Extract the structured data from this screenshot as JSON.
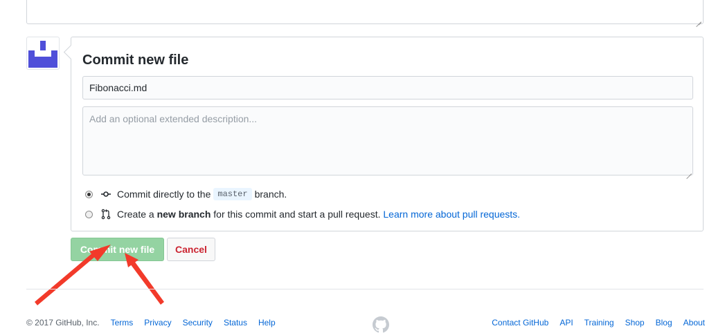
{
  "commit_form": {
    "title": "Commit new file",
    "summary_value": "Fibonacci.md",
    "description_placeholder": "Add an optional extended description...",
    "option_direct": {
      "prefix": "Commit directly to the",
      "branch": "master",
      "suffix": "branch.",
      "selected": true
    },
    "option_new_branch": {
      "prefix": "Create a",
      "bold": "new branch",
      "suffix": "for this commit and start a pull request.",
      "link": "Learn more about pull requests.",
      "selected": false
    },
    "commit_button": "Commit new file",
    "cancel_button": "Cancel"
  },
  "footer": {
    "copyright": "© 2017 GitHub, Inc.",
    "left_links": [
      "Terms",
      "Privacy",
      "Security",
      "Status",
      "Help"
    ],
    "right_links": [
      "Contact GitHub",
      "API",
      "Training",
      "Shop",
      "Blog",
      "About"
    ]
  },
  "icons": {
    "avatar": "identicon-avatar",
    "commit": "git-commit-icon",
    "pull_request": "git-pull-request-icon",
    "footer_logo": "github-mark-icon"
  },
  "colors": {
    "commit_button_bg": "#94d3a2",
    "cancel_text": "#cb2431",
    "link": "#0366d6",
    "avatar": "#4f4fd9",
    "annotation_arrows": "#f23a2a"
  }
}
